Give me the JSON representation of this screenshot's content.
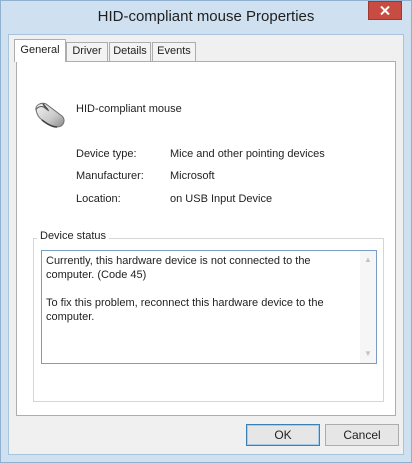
{
  "window": {
    "title": "HID-compliant mouse Properties"
  },
  "tabs": [
    {
      "label": "General",
      "active": true
    },
    {
      "label": "Driver",
      "active": false
    },
    {
      "label": "Details",
      "active": false
    },
    {
      "label": "Events",
      "active": false
    }
  ],
  "device": {
    "name": "HID-compliant mouse",
    "icon": "mouse-icon"
  },
  "properties": [
    {
      "label": "Device type:",
      "value": "Mice and other pointing devices"
    },
    {
      "label": "Manufacturer:",
      "value": "Microsoft"
    },
    {
      "label": "Location:",
      "value": "on USB Input Device"
    }
  ],
  "device_status": {
    "title": "Device status",
    "paragraphs": [
      "Currently, this hardware device is not connected to the computer. (Code 45)",
      "To fix this problem, reconnect this hardware device to the computer."
    ]
  },
  "buttons": {
    "ok": "OK",
    "cancel": "Cancel"
  },
  "colors": {
    "close_button": "#c94c43",
    "window_frame": "#cfe0f1"
  }
}
